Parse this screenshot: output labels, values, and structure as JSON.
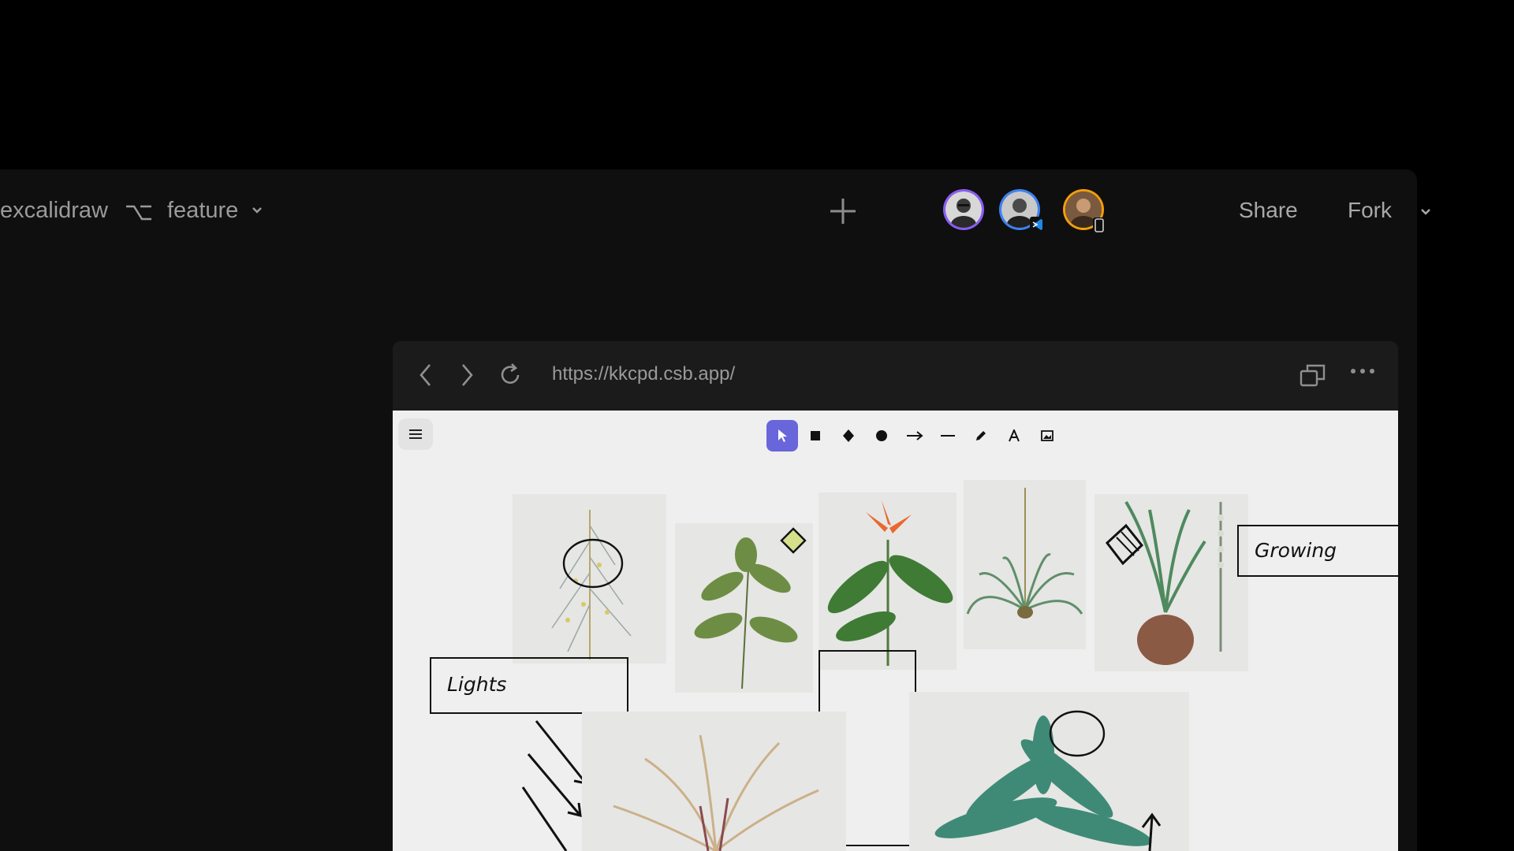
{
  "header": {
    "repo": "excalidraw",
    "branch": "feature",
    "share_label": "Share",
    "fork_label": "Fork"
  },
  "collaborators": [
    {
      "name": "avatar-1",
      "ring": "#8a5cf6"
    },
    {
      "name": "avatar-2",
      "ring": "#3b82f6",
      "badge": "vscode-icon"
    },
    {
      "name": "avatar-3",
      "ring": "#f59e0b",
      "badge": "phone-icon"
    }
  ],
  "browser": {
    "url": "https://kkcpd.csb.app/"
  },
  "excalidraw": {
    "tools": [
      "selection-tool",
      "rectangle-tool",
      "diamond-tool",
      "ellipse-tool",
      "arrow-tool",
      "line-tool",
      "draw-tool",
      "text-tool",
      "image-tool"
    ],
    "active_tool": "selection-tool",
    "labels": {
      "lights": "Lights",
      "growing": "Growing"
    }
  },
  "colors": {
    "accent": "#6965db",
    "background": "#000000",
    "panel": "#0f0f0f"
  }
}
